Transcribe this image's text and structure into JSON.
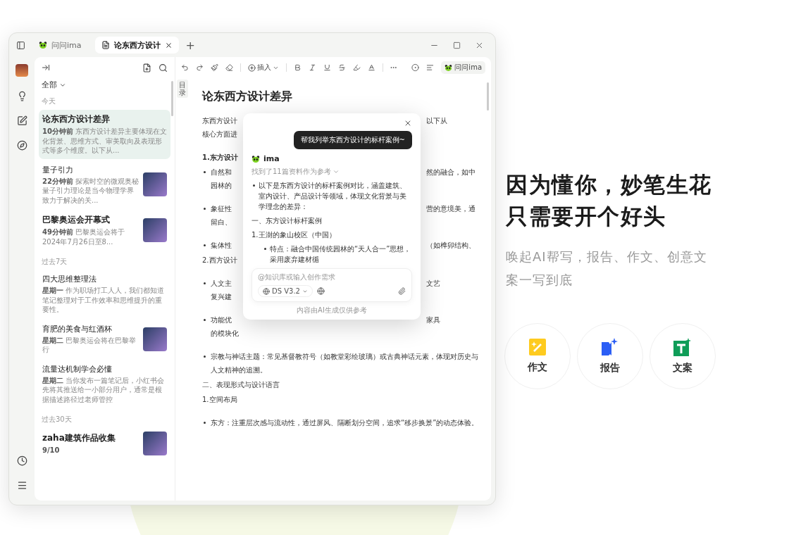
{
  "window": {
    "tabs": [
      {
        "label": "问问ima",
        "selected": false
      },
      {
        "label": "论东西方设计",
        "selected": true
      }
    ],
    "new_tab": "+"
  },
  "note_list": {
    "filter": "全部",
    "groups": [
      {
        "label": "今天",
        "notes": [
          {
            "title": "论东西方设计差异",
            "time": "10分钟前",
            "snippet": "东西方设计差异主要体现在文化背景、思维方式、审美取向及表现形式等多个维度。以下从...",
            "thumbnail": false,
            "bold": true,
            "selected": true
          },
          {
            "title": "量子引力",
            "time": "22分钟前",
            "snippet": "探索时空的微观奥秘量子引力理论是当今物理学界致力于解决的关...",
            "thumbnail": true,
            "bold": false,
            "selected": false
          },
          {
            "title": "巴黎奥运会开幕式",
            "time": "49分钟前",
            "snippet": "巴黎奥运会将于2024年7月26日至8...",
            "thumbnail": true,
            "bold": true,
            "selected": false
          }
        ]
      },
      {
        "label": "过去7天",
        "notes": [
          {
            "title": "四大思维整理法",
            "time": "星期一",
            "snippet": "作为职场打工人人，我们都知道笔记整理对于工作效率和思维提升的重要性。",
            "thumbnail": false,
            "bold": false,
            "selected": false
          },
          {
            "title": "育肥的美食与红酒杯",
            "time": "星期二",
            "snippet": "巴黎奥运会将在巴黎举行",
            "thumbnail": true,
            "bold": false,
            "selected": false
          },
          {
            "title": "流量达机制学会必懂",
            "time": "星期二",
            "snippet": "当你发布一篇笔记后，小红书会先将其推送给一小部分用户，通常是根据描述路径过老师管控",
            "thumbnail": false,
            "bold": false,
            "selected": false
          }
        ]
      },
      {
        "label": "过去30天",
        "notes": [
          {
            "title": "zaha建筑作品收集",
            "time": "9/10",
            "thumbnail": true,
            "bold": true,
            "selected": false
          }
        ]
      }
    ]
  },
  "toolbar": {
    "insert": "插入",
    "ask": "问问ima"
  },
  "outline_tab": "目录",
  "document": {
    "title": "论东西方设计差异",
    "lines": [
      {
        "kind": "paragraph",
        "left": "东西方设计",
        "right": "以下从"
      },
      {
        "kind": "continuation",
        "left": "核心方面进"
      },
      {
        "kind": "heading",
        "left": "1.东方设计"
      },
      {
        "kind": "bullet",
        "left": "自然和",
        "right": "然的融合，如中"
      },
      {
        "kind": "continuation",
        "left": "园林的"
      },
      {
        "kind": "bullet",
        "left": "象征性",
        "right": "营的意境美，通"
      },
      {
        "kind": "continuation",
        "left": "留白、"
      },
      {
        "kind": "bullet",
        "left": "集体性",
        "right": "（如榫卯结构、"
      },
      {
        "kind": "paragraph",
        "left": "2.西方设计"
      },
      {
        "kind": "bullet",
        "left": "人文主",
        "right": "文艺"
      },
      {
        "kind": "continuation",
        "left": "复兴建"
      },
      {
        "kind": "bullet",
        "left": "功能优",
        "right": "家具"
      },
      {
        "kind": "continuation",
        "left": "的模块化"
      },
      {
        "kind": "bullet",
        "left": "宗教与神话主题：常见基督教符号（如教堂彩绘玻璃）或古典神话元素，体现对历史与"
      },
      {
        "kind": "continuation",
        "left": "人文精神的追溯。"
      },
      {
        "kind": "paragraph",
        "left": "二、表现形式与设计语言"
      },
      {
        "kind": "paragraph",
        "left": "1.空间布局"
      },
      {
        "kind": "bullet",
        "left": "东方：注重层次感与流动性，通过屏风、隔断划分空间，追求“移步换景”的动态体验。"
      }
    ]
  },
  "assistant": {
    "prompt": "帮我列举东西方设计的标杆案例~",
    "name": "ima",
    "sources": "找到了11篇资料作为参考",
    "blocks": [
      {
        "kind": "bullet",
        "text": "以下是东西方设计的标杆案例对比，涵盖建筑、室内设计、产品设计等领域，体现文化背景与美学理念的差异："
      },
      {
        "kind": "paragraph",
        "text": "一、东方设计标杆案例"
      },
      {
        "kind": "paragraph",
        "text": "1.王澍的象山校区（中国）"
      },
      {
        "kind": "subbullet",
        "text": "特点：融合中国传统园林的“天人合一”思想，采用废弃建材循"
      }
    ],
    "input_placeholder": "@知识库或输入创作需求",
    "model": "DS V3.2",
    "disclaimer": "内容由AI生成仅供参考"
  },
  "promo": {
    "headline": "因为懂你，妙笔生花只需要开个好头",
    "subtitle": "唤起AI帮写，报告、作文、创意文案一写到底",
    "features": [
      {
        "kind": "essay",
        "label": "作文"
      },
      {
        "kind": "report",
        "label": "报告"
      },
      {
        "kind": "copy",
        "label": "文案"
      }
    ]
  }
}
